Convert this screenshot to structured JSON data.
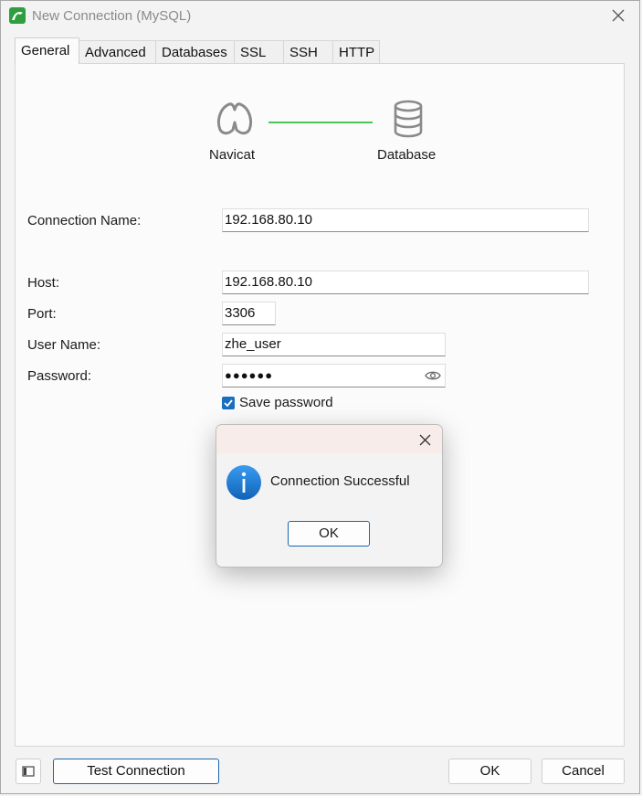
{
  "window": {
    "title": "New Connection (MySQL)"
  },
  "tabs": [
    {
      "label": "General",
      "active": true
    },
    {
      "label": "Advanced"
    },
    {
      "label": "Databases"
    },
    {
      "label": "SSL"
    },
    {
      "label": "SSH"
    },
    {
      "label": "HTTP"
    }
  ],
  "diagram": {
    "left_label": "Navicat",
    "right_label": "Database",
    "line_color": "#49c55a"
  },
  "form": {
    "connection_name": {
      "label": "Connection Name:",
      "value": "192.168.80.10"
    },
    "host": {
      "label": "Host:",
      "value": "192.168.80.10"
    },
    "port": {
      "label": "Port:",
      "value": "3306"
    },
    "user_name": {
      "label": "User Name:",
      "value": "zhe_user"
    },
    "password": {
      "label": "Password:",
      "masked": "●●●●●●"
    },
    "save_password": {
      "label": "Save password",
      "checked": true
    }
  },
  "buttons": {
    "test_connection": "Test Connection",
    "ok": "OK",
    "cancel": "Cancel"
  },
  "dialog": {
    "message": "Connection Successful",
    "ok": "OK",
    "icon": "info-icon"
  },
  "colors": {
    "accent": "#1a65b0",
    "info_blue": "#1a7fd6",
    "app_green": "#2e9e3e"
  }
}
